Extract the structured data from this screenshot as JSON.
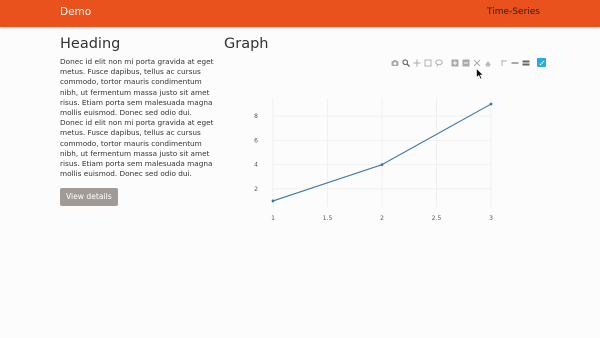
{
  "navbar": {
    "brand": "Demo",
    "link": "Time-Series"
  },
  "left": {
    "heading": "Heading",
    "paragraph": "Donec id elit non mi porta gravida at eget metus. Fusce dapibus, tellus ac cursus commodo, tortor mauris condimentum nibh, ut fermentum massa justo sit amet risus. Etiam porta sem malesuada magna mollis euismod. Donec sed odio dui. Donec id elit non mi porta gravida at eget metus. Fusce dapibus, tellus ac cursus commodo, tortor mauris condimentum nibh, ut fermentum massa justo sit amet risus. Etiam porta sem malesuada magna mollis euismod. Donec sed odio dui.",
    "button": "View details"
  },
  "graph": {
    "heading": "Graph",
    "modebar_icons": [
      "camera-icon",
      "zoom-icon",
      "pan-icon",
      "box-select-icon",
      "lasso-select-icon",
      "zoom-in-icon",
      "zoom-out-icon",
      "autoscale-icon",
      "reset-axes-icon",
      "spike-lines-icon",
      "hover-closest-icon",
      "hover-compare-icon",
      "plotly-logo-icon"
    ]
  },
  "chart_data": {
    "type": "line",
    "x": [
      1,
      2,
      3
    ],
    "y": [
      1,
      4,
      9
    ],
    "x_ticks": [
      "1",
      "1.5",
      "2",
      "2.5",
      "3"
    ],
    "y_ticks": [
      "2",
      "4",
      "6",
      "8"
    ],
    "xlim": [
      1,
      3
    ],
    "ylim": [
      0.5,
      9.5
    ],
    "grid": true,
    "line_color": "#3b78a8",
    "title": "",
    "xlabel": "",
    "ylabel": ""
  },
  "colors": {
    "navbar": "#e9521d",
    "button": "#a09b96",
    "line": "#3b78a8",
    "modebar_active": "#2aa8e0"
  }
}
